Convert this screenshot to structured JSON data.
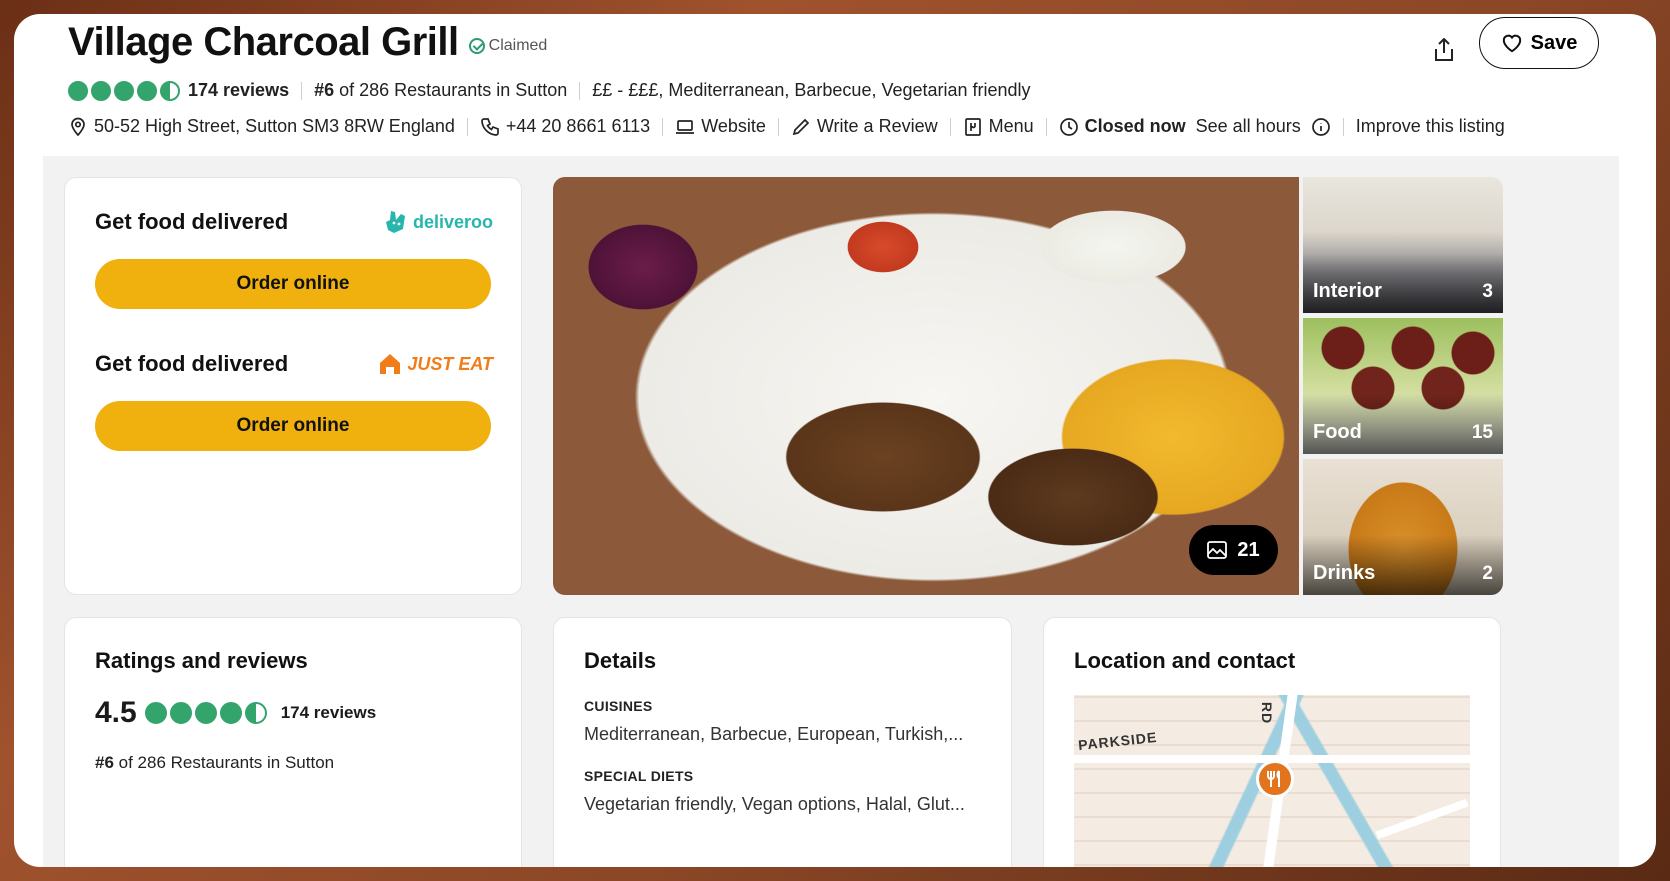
{
  "header": {
    "title": "Village Charcoal Grill",
    "claimed": "Claimed",
    "save_label": "Save"
  },
  "meta": {
    "reviews": "174 reviews",
    "rank_num": "#6",
    "rank_rest": " of 286 Restaurants in Sutton",
    "tags": "££ - £££, Mediterranean, Barbecue, Vegetarian friendly"
  },
  "info": {
    "address": "50-52 High Street, Sutton SM3 8RW England",
    "phone": "+44 20 8661 6113",
    "website": "Website",
    "write_review": "Write a Review",
    "menu": "Menu",
    "status": "Closed now",
    "hours": "See all hours",
    "improve": "Improve this listing"
  },
  "delivery": [
    {
      "title": "Get food delivered",
      "brand": "deliveroo",
      "button": "Order online"
    },
    {
      "title": "Get food delivered",
      "brand": "JUST EAT",
      "button": "Order online"
    }
  ],
  "photos": {
    "count": "21",
    "thumbs": [
      {
        "label": "Interior",
        "count": "3"
      },
      {
        "label": "Food",
        "count": "15"
      },
      {
        "label": "Drinks",
        "count": "2"
      }
    ]
  },
  "ratings": {
    "title": "Ratings and reviews",
    "score": "4.5",
    "reviews": "174 reviews",
    "rank_num": "#6",
    "rank_rest": " of 286 Restaurants in Sutton"
  },
  "details": {
    "title": "Details",
    "cuisines_label": "CUISINES",
    "cuisines": "Mediterranean, Barbecue, European, Turkish,...",
    "diets_label": "SPECIAL DIETS",
    "diets": "Vegetarian friendly, Vegan options, Halal, Glut..."
  },
  "location": {
    "title": "Location and contact",
    "map_label_1": "PARKSIDE",
    "map_label_2": "RD"
  },
  "colors": {
    "rating_green": "#34a46d",
    "order_button": "#f0b10f",
    "deliveroo": "#26b6ae",
    "justeat": "#f07d19"
  }
}
